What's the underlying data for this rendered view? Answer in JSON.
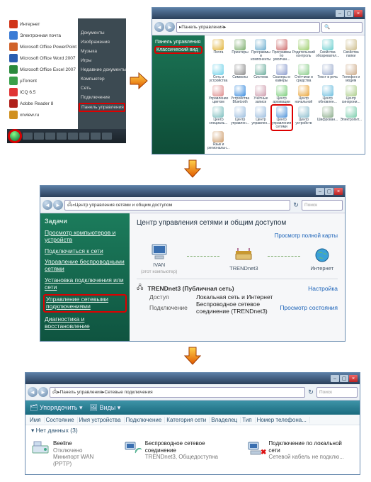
{
  "startmenu": {
    "left_items": [
      {
        "label": "Интернет",
        "color": "#d13418"
      },
      {
        "label": "Электронная почта",
        "color": "#3a7bd5"
      },
      {
        "label": "Microsoft Office PowerPoint 2007",
        "color": "#d0622a"
      },
      {
        "label": "Microsoft Office Word 2007",
        "color": "#2a5db0"
      },
      {
        "label": "Microsoft Office Excel 2007",
        "color": "#2a8a3c"
      },
      {
        "label": "µTorrent",
        "color": "#3aa04a"
      },
      {
        "label": "ICQ 6.5",
        "color": "#e03434"
      },
      {
        "label": "Adobe Reader 8",
        "color": "#b0201a"
      },
      {
        "label": "xnview.ru",
        "color": "#d09020"
      }
    ],
    "right_items": [
      "Документы",
      "Изображения",
      "Музыка",
      "Игры",
      "Недавние документы",
      "Компьютер",
      "Сеть",
      "Подключение"
    ],
    "right_highlight": "Панель управления"
  },
  "cp": {
    "address": "Панель управления",
    "side_highlight": "Классический вид",
    "side_items": [
      "Панель управления"
    ],
    "highlight_label": "Центр управления сетями и общим",
    "items": [
      "Почта",
      "Принтеры",
      "Программы и компоненты",
      "Программы по умолчан...",
      "Родительский контроль",
      "Свойства обозревател...",
      "Свойства папки",
      "Сеть и устройства",
      "Символы",
      "Система",
      "Сканеры и камеры",
      "Счётчики и средства",
      "Текст в речь",
      "Телефон и модем",
      "Управление цветом",
      "Устройства Bluetooth",
      "Учётные записи",
      "Центр архивации",
      "Центр начальной",
      "Центр обновлен...",
      "Центр синхрони...",
      "Центр специаль...",
      "Центр управлен...",
      "Центр управлен...",
      "Центр управления сетями",
      "Центр устройств",
      "Шифрован...",
      "Электропит...",
      "Язык и региональн..."
    ],
    "highlight_index": 24
  },
  "w2": {
    "title": "Центр управления сетями и общим доступом",
    "search_placeholder": "Поиск",
    "view_map": "Просмотр полной карты",
    "nodes": {
      "pc": "IVAN",
      "pc_sub": "(этот компьютер)",
      "router": "TRENDnet3",
      "internet": "Интернет"
    },
    "side_head": "Задачи",
    "side_links": [
      "Просмотр компьютеров и устройств",
      "Подключиться к сети",
      "Управление беспроводными сетями",
      "Установка подключения или сети"
    ],
    "side_highlight": "Управление сетевыми подключениями",
    "side_after": [
      "Диагностика и восстановление"
    ],
    "net_name": "TRENDnet3 (Публичная сеть)",
    "net_customize": "Настройка",
    "rows": [
      {
        "label": "Доступ",
        "val": "Локальная сеть и Интернет",
        "right": ""
      },
      {
        "label": "Подключение",
        "val": "Беспроводное сетевое соединение (TRENDnet3)",
        "right": "Просмотр состояния"
      }
    ]
  },
  "w3": {
    "breadcrumb1": "Панель управления",
    "breadcrumb2": "Сетевые подключения",
    "search_placeholder": "Поиск",
    "toolbar": {
      "organize": "Упорядочить",
      "views": "Виды"
    },
    "columns": [
      "Имя",
      "Состояние",
      "Имя устройства",
      "Подключение",
      "Категория сети",
      "Владелец",
      "Тип",
      "Номер телефона..."
    ],
    "group": "Нет данных (3)",
    "conns": [
      {
        "title": "Beeline",
        "sub": "Отключено",
        "sub2": "Минипорт WAN (PPTP)",
        "kind": "dialup"
      },
      {
        "title": "Беспроводное сетевое соединение",
        "sub": "TRENDnet3, Общедоступна",
        "sub2": "",
        "kind": "wifi"
      },
      {
        "title": "Подключение по локальной сети",
        "sub": "Сетевой кабель не подклю...",
        "sub2": "",
        "kind": "lan",
        "disabled": true
      }
    ]
  }
}
